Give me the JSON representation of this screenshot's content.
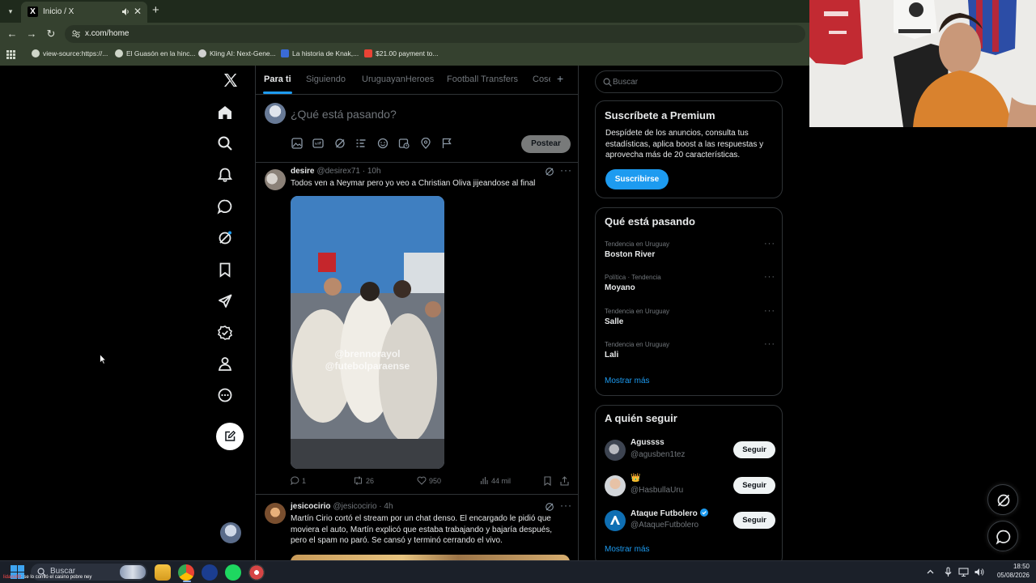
{
  "browser": {
    "tab_title": "Inicio / X",
    "tab_favicon": "X",
    "url": "x.com/home",
    "bookmarks": [
      {
        "label": "view-source:https://..."
      },
      {
        "label": "El Guasón en la hinc..."
      },
      {
        "label": "Kling AI: Next-Gene..."
      },
      {
        "label": "La historia de Knak,..."
      },
      {
        "label": "$21.00 payment to..."
      }
    ]
  },
  "sidebar": {
    "logo": "x-logo",
    "items": [
      "home-icon",
      "search-icon",
      "notifications-icon",
      "messages-icon",
      "grok-icon",
      "bookmarks-icon",
      "rocket-icon",
      "verified-icon",
      "profile-icon",
      "more-icon"
    ]
  },
  "timeline": {
    "tabs": [
      {
        "label": "Para ti",
        "active": true
      },
      {
        "label": "Siguiendo"
      },
      {
        "label": "UruguayanHeroes"
      },
      {
        "label": "Football Transfers"
      },
      {
        "label": "Cose"
      }
    ],
    "composer_placeholder": "¿Qué está pasando?",
    "post_button": "Postear",
    "tweets": [
      {
        "name": "desire",
        "handle": "@desirex71 · 10h",
        "text": "Todos ven a Neymar pero yo veo a Christian Oliva jijeandose al final",
        "media_watermark_1": "@brennorayol",
        "media_watermark_2": "@futebolparaense",
        "replies": "1",
        "reposts": "26",
        "likes": "950",
        "views": "44 mil"
      },
      {
        "name": "jesicocirio",
        "handle": "@jesicocirio · 4h",
        "text": "Martín Cirio cortó el stream por un chat denso. El encargado le pidió que moviera el auto, Martín explicó que estaba trabajando y bajaría después, pero el spam no paró. Se cansó y terminó cerrando el vivo."
      }
    ]
  },
  "right": {
    "search_placeholder": "Buscar",
    "premium": {
      "title": "Suscríbete a Premium",
      "text": "Despídete de los anuncios, consulta tus estadísticas, aplica boost a las respuestas y aprovecha más de 20 características.",
      "button": "Suscribirse"
    },
    "trends": {
      "title": "Qué está pasando",
      "items": [
        {
          "context": "Tendencia en Uruguay",
          "name": "Boston River"
        },
        {
          "context": "Política · Tendencia",
          "name": "Moyano"
        },
        {
          "context": "Tendencia en Uruguay",
          "name": "Salle"
        },
        {
          "context": "Tendencia en Uruguay",
          "name": "Lali"
        }
      ],
      "show_more": "Mostrar más"
    },
    "who_to_follow": {
      "title": "A quién seguir",
      "items": [
        {
          "name": "Agussss",
          "handle": "@agusben1tez",
          "button": "Seguir"
        },
        {
          "name": "👑",
          "handle": "@HasbullaUru",
          "button": "Seguir"
        },
        {
          "name": "Ataque Futbolero",
          "handle": "@AtaqueFutbolero",
          "button": "Seguir",
          "verified": true
        }
      ],
      "show_more": "Mostrar más"
    }
  },
  "taskbar": {
    "search_text": "Buscar",
    "ticker_user": "lidaxx89",
    "ticker_text": ": se lo comió el casino pobre ney",
    "time": "18:50",
    "date": "05/08/2026"
  },
  "colors": {
    "accent": "#1d9bf0",
    "background": "#000000",
    "border": "#2f3336",
    "chrome": "#35412f"
  }
}
